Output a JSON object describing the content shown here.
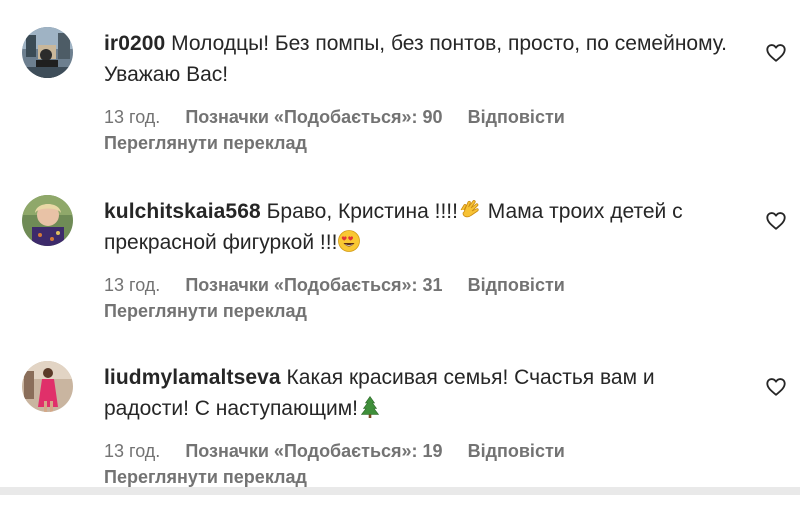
{
  "comments": [
    {
      "username": "ir0200",
      "text": "Молодцы! Без помпы, без понтов, просто, по семейному. Уважаю Вас!",
      "time": "13 год.",
      "likes": "Позначки «Подобається»: 90",
      "reply": "Відповісти",
      "translate": "Переглянути переклад",
      "avatar_icon": "avatar-photo",
      "like_icon": "heart-icon"
    },
    {
      "username": "kulchitskaia568",
      "text_part1": "Браво, Кристина !!!!",
      "emoji1": "clapping-hands-emoji",
      "text_part2": " Мама троих детей с прекрасной фигуркой !!!",
      "emoji2": "heart-eyes-emoji",
      "time": "13 год.",
      "likes": "Позначки «Подобається»: 31",
      "reply": "Відповісти",
      "translate": "Переглянути переклад",
      "avatar_icon": "avatar-photo",
      "like_icon": "heart-icon"
    },
    {
      "username": "liudmylamaltseva",
      "text_part1": "Какая красивая семья! Счастья вам и радости! С наступающим!",
      "emoji1": "christmas-tree-emoji",
      "time": "13 год.",
      "likes": "Позначки «Подобається»: 19",
      "reply": "Відповісти",
      "translate": "Переглянути переклад",
      "avatar_icon": "avatar-photo",
      "like_icon": "heart-icon"
    }
  ],
  "colors": {
    "text": "#262626",
    "muted": "#737373"
  }
}
